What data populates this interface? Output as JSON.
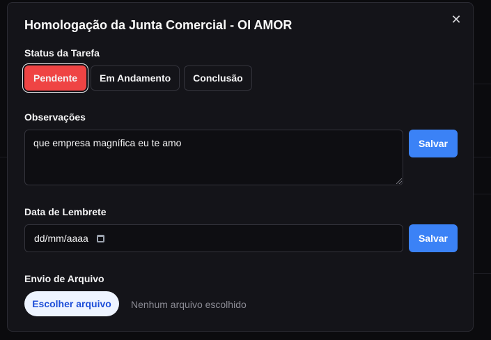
{
  "modal": {
    "title": "Homologação da Junta Comercial - OI AMOR",
    "close_icon": "close-icon"
  },
  "status": {
    "label": "Status da Tarefa",
    "options": [
      "Pendente",
      "Em Andamento",
      "Conclusão"
    ],
    "selected": "Pendente",
    "active_color": "#ef4444"
  },
  "notes": {
    "label": "Observações",
    "value": "que empresa magnífica eu te amo",
    "save_label": "Salvar"
  },
  "reminder": {
    "label": "Data de Lembrete",
    "placeholder": "dd/mm/aaaa",
    "icon": "calendar-icon",
    "save_label": "Salvar"
  },
  "upload": {
    "label": "Envio de Arquivo",
    "button_label": "Escolher arquivo",
    "status_text": "Nenhum arquivo escolhido"
  },
  "colors": {
    "primary": "#3b82f6",
    "danger": "#ef4444",
    "background": "#141419"
  }
}
